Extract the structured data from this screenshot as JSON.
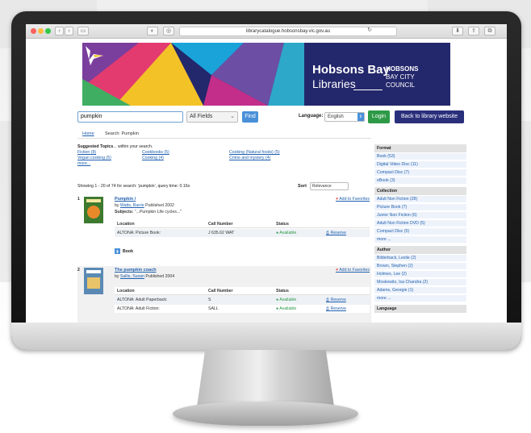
{
  "browser": {
    "url": "librarycatalogue.hobsonsbay.vic.gov.au"
  },
  "banner": {
    "brand_name": "Hobsons Bay",
    "brand_sub": "Libraries",
    "council_line1": "HOBSONS",
    "council_line2": "BAY CITY",
    "council_line3": "COUNCIL"
  },
  "search": {
    "query": "pumpkin",
    "scope": "All Fields",
    "find_label": "Find",
    "language_label": "Language:",
    "language_value": "English",
    "login_label": "Login",
    "back_label": "Back to library website"
  },
  "breadcrumb": {
    "home": "Home",
    "current": "Search: Pumpkin"
  },
  "topics": {
    "heading_bold": "Suggested Topics",
    "heading_rest": "... within your search.",
    "items": [
      "Fiction (8)",
      "Cookbooks (5)",
      "Cooking (Natural foods) (5)",
      "Vegan cooking (5)",
      "Cooking (4)",
      "Crime and mystery (4)"
    ],
    "more": "more..."
  },
  "results_info": {
    "showing": "Showing 1 - 20 of 74 for search: 'pumpkin', query time: 0.16s",
    "sort_label": "Sort",
    "sort_value": "Relevance"
  },
  "results": [
    {
      "num": "1",
      "title": "Pumpkin /",
      "by_prefix": "by ",
      "author": "Watts, Barrie",
      "published": " Published 2002",
      "subjects_label": "Subjects:",
      "subjects": " \"...Pumpkin Life cycles...\"",
      "favorite": "Add to Favorites",
      "holdings_header": [
        "Location",
        "Call Number",
        "Status"
      ],
      "holdings": [
        {
          "location": "ALTONA: Picture Book:",
          "call": "J 635.62 WAT",
          "status": "Available",
          "action": "Reserve"
        }
      ],
      "format": "Book"
    },
    {
      "num": "2",
      "title": "The pumpkin coach",
      "by_prefix": "by ",
      "author": "Sallis, Susan",
      "published": " Published 2004",
      "favorite": "Add to Favorites",
      "holdings_header": [
        "Location",
        "Call Number",
        "Status"
      ],
      "holdings": [
        {
          "location": "ALTONA: Adult Paperback:",
          "call": "S",
          "status": "Available",
          "action": "Reserve"
        },
        {
          "location": "ALTONA: Adult Fiction:",
          "call": "SALL",
          "status": "Available",
          "action": "Reserve"
        }
      ]
    }
  ],
  "facets": {
    "format_head": "Format",
    "format_items": [
      "Book (53)",
      "Digital Video Disc (11)",
      "Compact Disc (7)",
      "eBook (3)"
    ],
    "collection_head": "Collection",
    "collection_items": [
      "Adult Non Fiction (28)",
      "Picture Book (7)",
      "Junior Non Fiction (6)",
      "Adult Non Fiction DVD (5)",
      "Compact Disc (5)",
      "more ..."
    ],
    "author_head": "Author",
    "author_items": [
      "Bilderback, Leslie (2)",
      "Brown, Stephen (2)",
      "Holmes, Lee (2)",
      "Moskowitz, Isa Chandra (2)",
      "Adams, Georgie (1)",
      "more ..."
    ],
    "language_head": "Language"
  },
  "colors": {
    "brand_navy": "#23276b",
    "link_blue": "#1f5fae",
    "login_green": "#2e9a47"
  }
}
